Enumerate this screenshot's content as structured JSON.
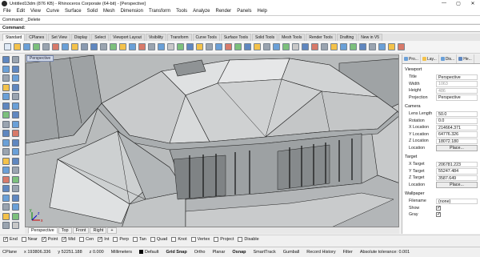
{
  "window": {
    "title": "Untitled13dm (876 KB) - Rhinoceros Corporate (64-bit) - [Perspective]",
    "controls": [
      "—",
      "▢",
      "✕"
    ]
  },
  "menu": [
    "File",
    "Edit",
    "View",
    "Curve",
    "Surface",
    "Solid",
    "Mesh",
    "Dimension",
    "Transform",
    "Tools",
    "Analyze",
    "Render",
    "Panels",
    "Help"
  ],
  "command_history": "Command: _Delete",
  "command_prompt": "Command:",
  "toolbar_tabs": [
    "Standard",
    "CPlanes",
    "Set View",
    "Display",
    "Select",
    "Viewport Layout",
    "Visibility",
    "Transform",
    "Curve Tools",
    "Surface Tools",
    "Solid Tools",
    "Mesh Tools",
    "Render Tools",
    "Drafting",
    "New in V5"
  ],
  "toolbar_tabs_active": 0,
  "toolbar_icon_colors": [
    "#dfe9f5",
    "#f4c24a",
    "#6aa0d8",
    "#7cc07c",
    "#9aa4b0",
    "#d87a6a",
    "#6aa0d8",
    "#f4c24a",
    "#8a9ab0",
    "#5f87c0",
    "#9aa4b0",
    "#7cc07c",
    "#f4c24a",
    "#6aa0d8",
    "#d87a6a",
    "#9aa4b0",
    "#6aa0d8",
    "#c8c8c8",
    "#7cc07c",
    "#5f87c0",
    "#f4c24a",
    "#9aa4b0",
    "#6aa0d8",
    "#d87a6a",
    "#7cc07c",
    "#5f87c0",
    "#f4c24a",
    "#9aa4b0",
    "#6aa0d8",
    "#7cc07c",
    "#c8c8c8",
    "#5f87c0",
    "#d87a6a",
    "#9aa4b0",
    "#f4c24a",
    "#6aa0d8",
    "#7cc07c",
    "#5f87c0",
    "#9aa4b0",
    "#6aa0d8",
    "#f4c24a",
    "#d87a6a"
  ],
  "left_tool_colors": [
    "#5f87c0",
    "#9aa4b0",
    "#6aa0d8",
    "#5f87c0",
    "#9aa4b0",
    "#6aa0d8",
    "#f4c24a",
    "#5f87c0",
    "#6aa0d8",
    "#9aa4b0",
    "#5f87c0",
    "#6aa0d8",
    "#7cc07c",
    "#5f87c0",
    "#9aa4b0",
    "#6aa0d8",
    "#5f87c0",
    "#d87a6a",
    "#6aa0d8",
    "#5f87c0",
    "#9aa4b0",
    "#6aa0d8",
    "#f4c24a",
    "#5f87c0",
    "#6aa0d8",
    "#9aa4b0",
    "#d87a6a",
    "#7cc07c",
    "#5f87c0",
    "#9aa4b0",
    "#6aa0d8",
    "#5f87c0",
    "#9aa4b0",
    "#6aa0d8",
    "#f4c24a",
    "#7cc07c",
    "#9aa4b0",
    "#c8c8c8"
  ],
  "viewport": {
    "label": "Perspective"
  },
  "viewport_tabs": [
    "Perspective",
    "Top",
    "Front",
    "Right",
    "+"
  ],
  "viewport_tabs_active": 0,
  "osnaps": [
    {
      "label": "End",
      "checked": true
    },
    {
      "label": "Near",
      "checked": false
    },
    {
      "label": "Point",
      "checked": true
    },
    {
      "label": "Mid",
      "checked": true
    },
    {
      "label": "Cen",
      "checked": false
    },
    {
      "label": "Int",
      "checked": true
    },
    {
      "label": "Perp",
      "checked": false
    },
    {
      "label": "Tan",
      "checked": false
    },
    {
      "label": "Quad",
      "checked": false
    },
    {
      "label": "Knot",
      "checked": false
    },
    {
      "label": "Vertex",
      "checked": false
    },
    {
      "label": "Project",
      "checked": false
    },
    {
      "label": "Disable",
      "checked": false
    }
  ],
  "status": {
    "cplane": "CPlane",
    "x": "x 193806.336",
    "y": "y 52251.188",
    "z": "z 0.000",
    "units": "Millimeters",
    "layer": "Default",
    "grid_snap": "Grid Snap",
    "ortho": "Ortho",
    "planar": "Planar",
    "osnap": "Osnap",
    "smarttrack": "SmartTrack",
    "gumball": "Gumball",
    "record_history": "Record History",
    "filter": "Filter",
    "tolerance": "Absolute tolerance: 0.001"
  },
  "panel": {
    "tabs": [
      {
        "label": "Pro...",
        "icon_color": "#6aa0d8"
      },
      {
        "label": "Lay...",
        "icon_color": "#f4c24a"
      },
      {
        "label": "Dis...",
        "icon_color": "#6aa0d8"
      },
      {
        "label": "He...",
        "icon_color": "#5f87c0"
      }
    ],
    "sections": [
      {
        "title": "Viewport",
        "rows": [
          {
            "key": "Title",
            "value": "Perspective",
            "dim": false
          },
          {
            "key": "Width",
            "value": "1063",
            "dim": true
          },
          {
            "key": "Height",
            "value": "486",
            "dim": true
          },
          {
            "key": "Projection",
            "value": "Perspective",
            "dim": false
          }
        ]
      },
      {
        "title": "Camera",
        "rows": [
          {
            "key": "Lens Length",
            "value": "50.0",
            "dim": false
          },
          {
            "key": "Rotation",
            "value": "0.0",
            "dim": false
          },
          {
            "key": "X Location",
            "value": "214664.371",
            "dim": false
          },
          {
            "key": "Y Location",
            "value": "64776.326",
            "dim": false
          },
          {
            "key": "Z Location",
            "value": "18072.180",
            "dim": false
          },
          {
            "key": "Location",
            "button": "Place..."
          }
        ]
      },
      {
        "title": "Target",
        "rows": [
          {
            "key": "X Target",
            "value": "206781.223",
            "dim": false
          },
          {
            "key": "Y Target",
            "value": "55247.484",
            "dim": false
          },
          {
            "key": "Z Target",
            "value": "3587.649",
            "dim": false
          },
          {
            "key": "Location",
            "button": "Place..."
          }
        ]
      },
      {
        "title": "Wallpaper",
        "rows": [
          {
            "key": "Filename",
            "value": "(none)",
            "dim": false
          },
          {
            "key": "Show",
            "check": true
          },
          {
            "key": "Gray",
            "check": true
          }
        ]
      }
    ]
  }
}
